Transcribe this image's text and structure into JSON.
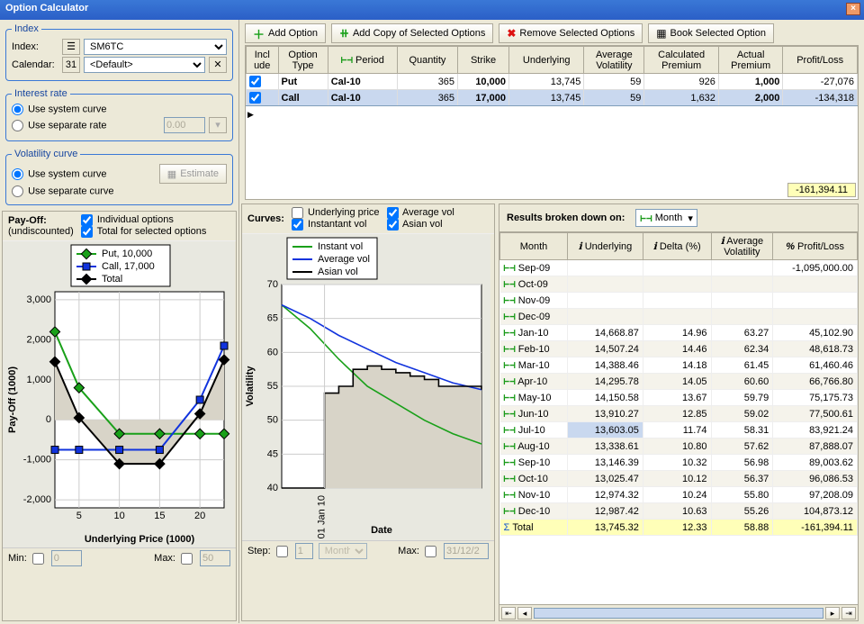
{
  "window": {
    "title": "Option Calculator"
  },
  "index_panel": {
    "legend": "Index",
    "index_label": "Index:",
    "index_value": "SM6TC",
    "calendar_label": "Calendar:",
    "calendar_value": "<Default>"
  },
  "interest_panel": {
    "legend": "Interest rate",
    "opt_system": "Use system curve",
    "opt_separate": "Use separate rate",
    "rate_value": "0.00"
  },
  "vol_panel": {
    "legend": "Volatility curve",
    "opt_system": "Use system curve",
    "opt_separate": "Use separate curve",
    "estimate_btn": "Estimate"
  },
  "payoff_panel": {
    "legend": "Pay-Off:",
    "sub": "(undiscounted)",
    "cb1": "Individual options",
    "cb2": "Total for selected options",
    "min_lbl": "Min:",
    "min_val": "0",
    "max_lbl": "Max:",
    "max_val": "50"
  },
  "curves_panel": {
    "legend": "Curves:",
    "cb1": "Underlying price",
    "cb2": "Average vol",
    "cb3": "Instantant vol",
    "cb4": "Asian vol",
    "step_lbl": "Step:",
    "step_val": "1",
    "step_unit": "Month",
    "max_lbl": "Max:",
    "max_val": "31/12/2"
  },
  "toolbar": {
    "add": "Add Option",
    "addcopy": "Add Copy of Selected Options",
    "remove": "Remove Selected Options",
    "book": "Book Selected Option"
  },
  "grid": {
    "cols": [
      "Incl\nude",
      "Option\nType",
      "Period",
      "Quantity",
      "Strike",
      "Underlying",
      "Average\nVolatility",
      "Calculated\nPremium",
      "Actual\nPremium",
      "Profit/Loss"
    ],
    "rows": [
      {
        "type": "Put",
        "period": "Cal-10",
        "qty": "365",
        "strike": "10,000",
        "under": "13,745",
        "avol": "59",
        "cprem": "926",
        "aprem": "1,000",
        "pl": "-27,076"
      },
      {
        "type": "Call",
        "period": "Cal-10",
        "qty": "365",
        "strike": "17,000",
        "under": "13,745",
        "avol": "59",
        "cprem": "1,632",
        "aprem": "2,000",
        "pl": "-134,318"
      }
    ],
    "total": "-161,394.11"
  },
  "results": {
    "legend": "Results broken down on:",
    "unit": "Month",
    "cols": [
      "Month",
      "Underlying",
      "Delta (%)",
      "Average\nVolatility",
      "Profit/Loss"
    ],
    "rows": [
      {
        "m": "Sep-09",
        "u": "",
        "d": "",
        "v": "",
        "p": "-1,095,000.00"
      },
      {
        "m": "Oct-09",
        "u": "",
        "d": "",
        "v": "",
        "p": ""
      },
      {
        "m": "Nov-09",
        "u": "",
        "d": "",
        "v": "",
        "p": ""
      },
      {
        "m": "Dec-09",
        "u": "",
        "d": "",
        "v": "",
        "p": ""
      },
      {
        "m": "Jan-10",
        "u": "14,668.87",
        "d": "14.96",
        "v": "63.27",
        "p": "45,102.90"
      },
      {
        "m": "Feb-10",
        "u": "14,507.24",
        "d": "14.46",
        "v": "62.34",
        "p": "48,618.73"
      },
      {
        "m": "Mar-10",
        "u": "14,388.46",
        "d": "14.18",
        "v": "61.45",
        "p": "61,460.46"
      },
      {
        "m": "Apr-10",
        "u": "14,295.78",
        "d": "14.05",
        "v": "60.60",
        "p": "66,766.80"
      },
      {
        "m": "May-10",
        "u": "14,150.58",
        "d": "13.67",
        "v": "59.79",
        "p": "75,175.73"
      },
      {
        "m": "Jun-10",
        "u": "13,910.27",
        "d": "12.85",
        "v": "59.02",
        "p": "77,500.61"
      },
      {
        "m": "Jul-10",
        "u": "13,603.05",
        "d": "11.74",
        "v": "58.31",
        "p": "83,921.24",
        "hl": true
      },
      {
        "m": "Aug-10",
        "u": "13,338.61",
        "d": "10.80",
        "v": "57.62",
        "p": "87,888.07"
      },
      {
        "m": "Sep-10",
        "u": "13,146.39",
        "d": "10.32",
        "v": "56.98",
        "p": "89,003.62"
      },
      {
        "m": "Oct-10",
        "u": "13,025.47",
        "d": "10.12",
        "v": "56.37",
        "p": "96,086.53"
      },
      {
        "m": "Nov-10",
        "u": "12,974.32",
        "d": "10.24",
        "v": "55.80",
        "p": "97,208.09"
      },
      {
        "m": "Dec-10",
        "u": "12,987.42",
        "d": "10.63",
        "v": "55.26",
        "p": "104,873.12"
      }
    ],
    "total": {
      "m": "Total",
      "u": "13,745.32",
      "d": "12.33",
      "v": "58.88",
      "p": "-161,394.11"
    }
  },
  "chart_data": [
    {
      "id": "payoff",
      "type": "line",
      "title": "",
      "xlabel": "Underlying Price (1000)",
      "ylabel": "Pay-Off (1000)",
      "xticks": [
        5,
        10,
        15,
        20
      ],
      "yticks": [
        -2000,
        -1000,
        0,
        1000,
        2000,
        3000
      ],
      "xlim": [
        2,
        23
      ],
      "ylim": [
        -2200,
        3200
      ],
      "series": [
        {
          "name": "Put, 10,000",
          "color": "#19a019",
          "marker": "diamond",
          "x": [
            2,
            5,
            10,
            15,
            20,
            23
          ],
          "y": [
            2200,
            800,
            -350,
            -350,
            -350,
            -350
          ]
        },
        {
          "name": "Call, 17,000",
          "color": "#1133dd",
          "marker": "square",
          "x": [
            2,
            5,
            10,
            15,
            20,
            23
          ],
          "y": [
            -750,
            -750,
            -750,
            -750,
            500,
            1850
          ]
        },
        {
          "name": "Total",
          "color": "#000000",
          "marker": "diamond",
          "fill": "#d8d4c8",
          "x": [
            2,
            5,
            10,
            15,
            20,
            23
          ],
          "y": [
            1450,
            50,
            -1100,
            -1100,
            150,
            1500
          ]
        }
      ]
    },
    {
      "id": "curves",
      "type": "line",
      "title": "",
      "xlabel": "Date",
      "ylabel": "Volatility",
      "xticks": [
        "01 Jan 10"
      ],
      "yticks": [
        40,
        45,
        50,
        55,
        60,
        65,
        70
      ],
      "xlim": [
        0,
        14
      ],
      "ylim": [
        40,
        70
      ],
      "series": [
        {
          "name": "Instant vol",
          "color": "#19a019",
          "points": [
            [
              0,
              67
            ],
            [
              2,
              63.5
            ],
            [
              4,
              59
            ],
            [
              6,
              55
            ],
            [
              8,
              52.5
            ],
            [
              10,
              50
            ],
            [
              12,
              48
            ],
            [
              14,
              46.5
            ]
          ]
        },
        {
          "name": "Average vol",
          "color": "#1133dd",
          "points": [
            [
              0,
              67
            ],
            [
              2,
              65
            ],
            [
              4,
              62.5
            ],
            [
              6,
              60.5
            ],
            [
              8,
              58.5
            ],
            [
              10,
              57
            ],
            [
              12,
              55.5
            ],
            [
              14,
              54.5
            ]
          ]
        },
        {
          "name": "Asian vol",
          "color": "#000000",
          "step": true,
          "fill": "#d8d4c8",
          "points": [
            [
              0,
              40
            ],
            [
              3,
              40
            ],
            [
              3,
              54
            ],
            [
              4,
              55
            ],
            [
              5,
              57.5
            ],
            [
              6,
              58
            ],
            [
              7,
              57.5
            ],
            [
              8,
              57
            ],
            [
              9,
              56.5
            ],
            [
              10,
              56
            ],
            [
              11,
              55
            ],
            [
              12,
              55
            ],
            [
              13,
              55
            ],
            [
              14,
              54.5
            ]
          ]
        }
      ]
    }
  ]
}
